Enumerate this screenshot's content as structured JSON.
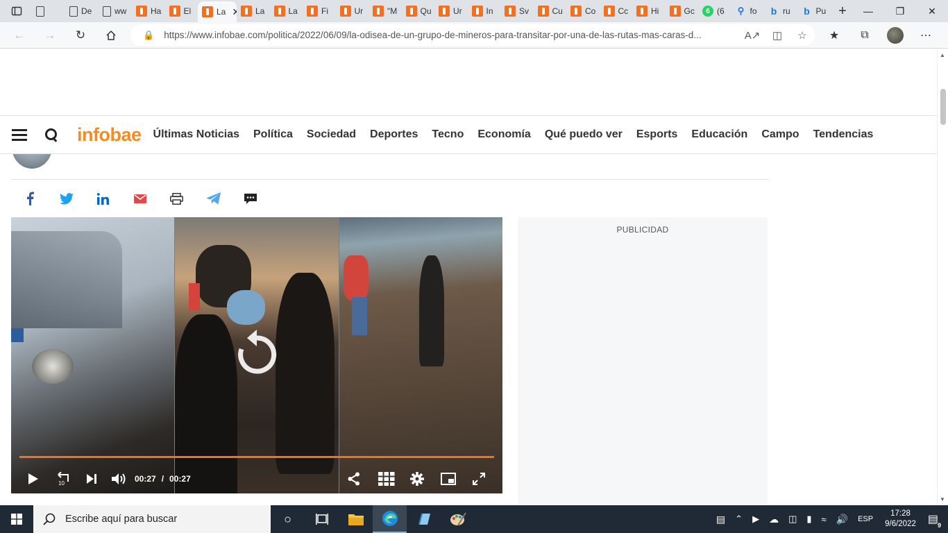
{
  "browser": {
    "tabs": [
      {
        "label": "",
        "icon": "doc",
        "type": "doc"
      },
      {
        "label": "De",
        "icon": "doc",
        "type": "doc"
      },
      {
        "label": "ww",
        "icon": "doc",
        "type": "doc"
      },
      {
        "label": "Ha",
        "icon": "infobae",
        "type": "ib"
      },
      {
        "label": "El",
        "icon": "infobae",
        "type": "ib"
      },
      {
        "label": "La",
        "icon": "infobae",
        "type": "ib",
        "active": true
      },
      {
        "label": "La",
        "icon": "infobae",
        "type": "ib"
      },
      {
        "label": "La",
        "icon": "infobae",
        "type": "ib"
      },
      {
        "label": "Fi",
        "icon": "infobae",
        "type": "ib"
      },
      {
        "label": "Ur",
        "icon": "infobae",
        "type": "ib"
      },
      {
        "label": "\"M",
        "icon": "infobae",
        "type": "ib"
      },
      {
        "label": "Qu",
        "icon": "infobae",
        "type": "ib"
      },
      {
        "label": "Ur",
        "icon": "infobae",
        "type": "ib"
      },
      {
        "label": "In",
        "icon": "infobae",
        "type": "ib"
      },
      {
        "label": "Sv",
        "icon": "infobae",
        "type": "ib"
      },
      {
        "label": "Cu",
        "icon": "infobae",
        "type": "ib"
      },
      {
        "label": "Co",
        "icon": "infobae",
        "type": "ib"
      },
      {
        "label": "Cc",
        "icon": "infobae",
        "type": "ib"
      },
      {
        "label": "Hi",
        "icon": "infobae",
        "type": "ib"
      },
      {
        "label": "Gc",
        "icon": "infobae",
        "type": "ib"
      },
      {
        "label": "(6",
        "icon": "whatsapp",
        "type": "wa",
        "badge": "6"
      },
      {
        "label": "fo",
        "icon": "search",
        "type": "search"
      },
      {
        "label": "ru",
        "icon": "bing",
        "type": "bing"
      },
      {
        "label": "Pu",
        "icon": "bing",
        "type": "bing"
      }
    ],
    "url": "https://www.infobae.com/politica/2022/06/09/la-odisea-de-un-grupo-de-mineros-para-transitar-por-una-de-las-rutas-mas-caras-d..."
  },
  "site": {
    "logo": "infobae",
    "logo_color": "#f68b1f",
    "menu": [
      "Últimas Noticias",
      "Política",
      "Sociedad",
      "Deportes",
      "Tecno",
      "Economía",
      "Qué puedo ver",
      "Esports",
      "Educación",
      "Campo",
      "Tendencias"
    ]
  },
  "share": [
    "facebook-icon",
    "twitter-icon",
    "linkedin-icon",
    "email-icon",
    "print-icon",
    "telegram-icon",
    "comments-icon"
  ],
  "video": {
    "current_time": "00:27",
    "separator": "/",
    "duration": "00:27",
    "progress": 1.0,
    "progress_color": "#f37021"
  },
  "ad": {
    "label": "PUBLICIDAD"
  },
  "taskbar": {
    "search_placeholder": "Escribe aquí para buscar",
    "language": "ESP",
    "time": "17:28",
    "date": "9/6/2022",
    "notifications": "9"
  }
}
